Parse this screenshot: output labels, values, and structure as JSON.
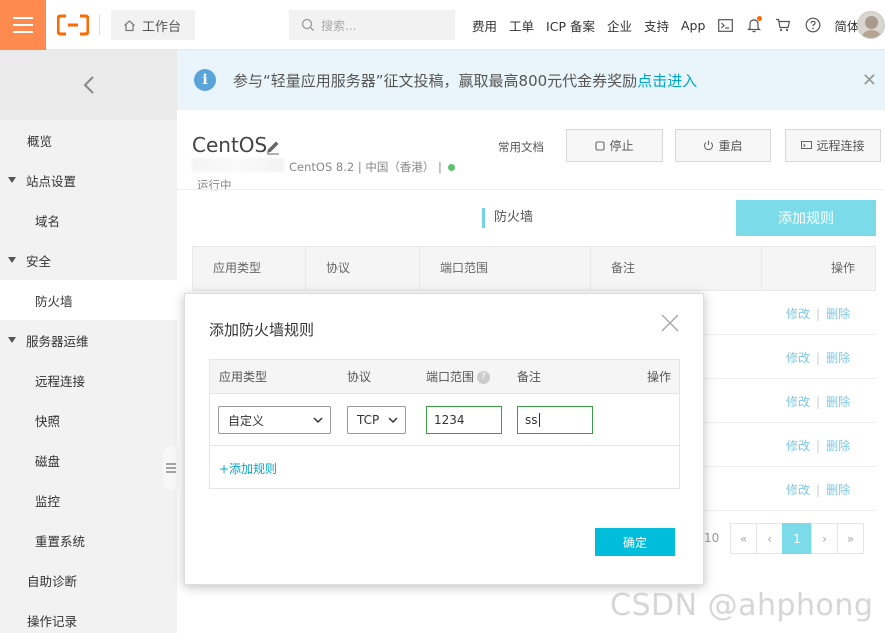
{
  "topbar": {
    "workbench_label": "工作台",
    "search_placeholder": "搜索...",
    "nav": [
      "费用",
      "工单",
      "ICP 备案",
      "企业",
      "支持",
      "App"
    ],
    "lang": "简体",
    "icons": [
      "terminal-icon",
      "bell-icon",
      "cart-icon",
      "help-icon"
    ]
  },
  "sidebar": {
    "items": [
      {
        "label": "概览"
      },
      {
        "label": "站点设置"
      },
      {
        "label": "域名"
      },
      {
        "label": "安全"
      },
      {
        "label": "防火墙"
      },
      {
        "label": "服务器运维"
      },
      {
        "label": "远程连接"
      },
      {
        "label": "快照"
      },
      {
        "label": "磁盘"
      },
      {
        "label": "监控"
      },
      {
        "label": "重置系统"
      },
      {
        "label": "自助诊断"
      },
      {
        "label": "操作记录"
      }
    ],
    "active": "防火墙"
  },
  "banner": {
    "text": "参与“轻量应用服务器”征文投稿，赢取最高800元代金券奖励",
    "link": "点击进入"
  },
  "instance": {
    "title": "CentOS",
    "meta": "CentOS 8.2 | 中国（香港） |",
    "status": "运行中",
    "docs": "常用文档",
    "stop": "停止",
    "restart": "重启",
    "remote": "远程连接"
  },
  "firewall": {
    "tab": "防火墙",
    "add_rule": "添加规则",
    "columns": [
      "应用类型",
      "协议",
      "端口范围",
      "备注",
      "操作"
    ],
    "rows": [
      {
        "edit": "修改",
        "delete": "删除"
      },
      {
        "edit": "修改",
        "delete": "删除"
      },
      {
        "edit": "修改",
        "delete": "删除"
      },
      {
        "edit": "修改",
        "delete": "删除"
      },
      {
        "edit": "修改",
        "delete": "删除"
      }
    ],
    "pager": {
      "total_text": "10",
      "first": "«",
      "prev": "‹",
      "current": "1",
      "next": "›",
      "last": "»"
    }
  },
  "dialog": {
    "title": "添加防火墙规则",
    "columns": [
      "应用类型",
      "协议",
      "端口范围",
      "备注",
      "操作"
    ],
    "row": {
      "app_type": "自定义",
      "protocol": "TCP",
      "port": "1234",
      "note": "ss"
    },
    "add_link": "+添加规则",
    "confirm": "确定"
  },
  "watermark": "CSDN @ahphong",
  "colors": {
    "accent": "#00bedb",
    "menu_orange": "#ff8a4f",
    "link": "#00a6c9"
  }
}
